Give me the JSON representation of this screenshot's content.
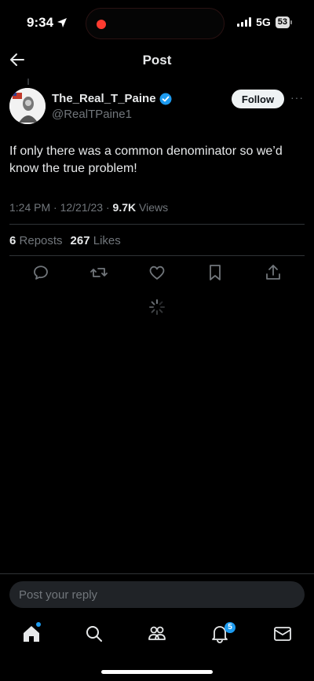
{
  "status_bar": {
    "time": "9:34",
    "network": "5G",
    "battery": "53"
  },
  "header": {
    "title": "Post"
  },
  "post": {
    "author_name": "The_Real_T_Paine",
    "handle": "@RealTPaine1",
    "follow_label": "Follow",
    "text": "If only there was a common denominator so we’d know the true problem!",
    "time": "1:24 PM",
    "date": "12/21/23",
    "views_count": "9.7K",
    "views_label": "Views",
    "reposts_count": "6",
    "reposts_label": "Reposts",
    "likes_count": "267",
    "likes_label": "Likes"
  },
  "reply": {
    "placeholder": "Post your reply"
  },
  "tabbar": {
    "notifications_badge": "5"
  },
  "colors": {
    "background": "#000000",
    "accent": "#1d9bf0",
    "text_primary": "#e7e9ea",
    "text_secondary": "#71767b",
    "recording": "#ff3b30"
  }
}
